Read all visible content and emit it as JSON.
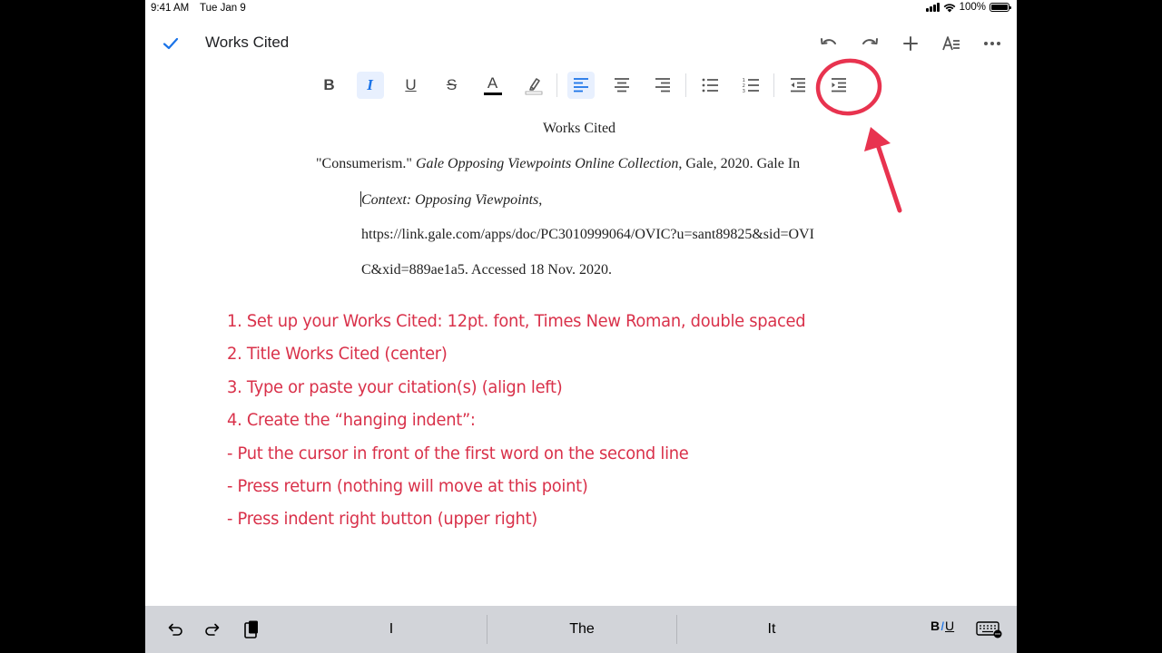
{
  "status_bar": {
    "time": "9:41 AM",
    "date": "Tue Jan 9",
    "battery": "100%",
    "icons": [
      "cellular-signal-icon",
      "wifi-icon",
      "battery-icon"
    ]
  },
  "app_bar": {
    "title": "Works Cited",
    "icons": [
      "checkmark-icon",
      "undo-icon",
      "redo-icon",
      "plus-icon",
      "text-format-icon",
      "more-icon"
    ]
  },
  "format_toolbar": {
    "bold": "B",
    "italic": "I",
    "underline": "U",
    "strikethrough": "S",
    "text_color": "A",
    "accent_color": "#1a73e8",
    "active_items": [
      "italic",
      "align-left"
    ]
  },
  "document": {
    "heading": "Works Cited",
    "citation": {
      "part1": "\"Consumerism.\" ",
      "part2_italic": "Gale Opposing Viewpoints Online Collection",
      "part3": ", Gale, 2020. Gale In",
      "line2_italic": "Context: Opposing Viewpoints",
      "line2_rest": ",",
      "line3": "https://link.gale.com/apps/doc/PC3010999064/OVIC?u=sant89825&sid=OVI",
      "line4": "C&xid=889ae1a5. Accessed 18 Nov. 2020."
    }
  },
  "notes": {
    "color": "#d9314a",
    "lines": [
      "1. Set up your Works Cited: 12pt. font, Times New Roman, double spaced",
      "2. Title Works Cited (center)",
      "3. Type or paste your citation(s) (align left)",
      "4. Create the “hanging indent”:",
      "- Put the cursor in front of the first word on the second line",
      "- Press return (nothing will move at this point)",
      "- Press indent right button (upper right)"
    ]
  },
  "keyboard_bar": {
    "suggestions": [
      "I",
      "The",
      "It"
    ],
    "format_b": "B",
    "format_i": "I",
    "format_u": "U"
  }
}
